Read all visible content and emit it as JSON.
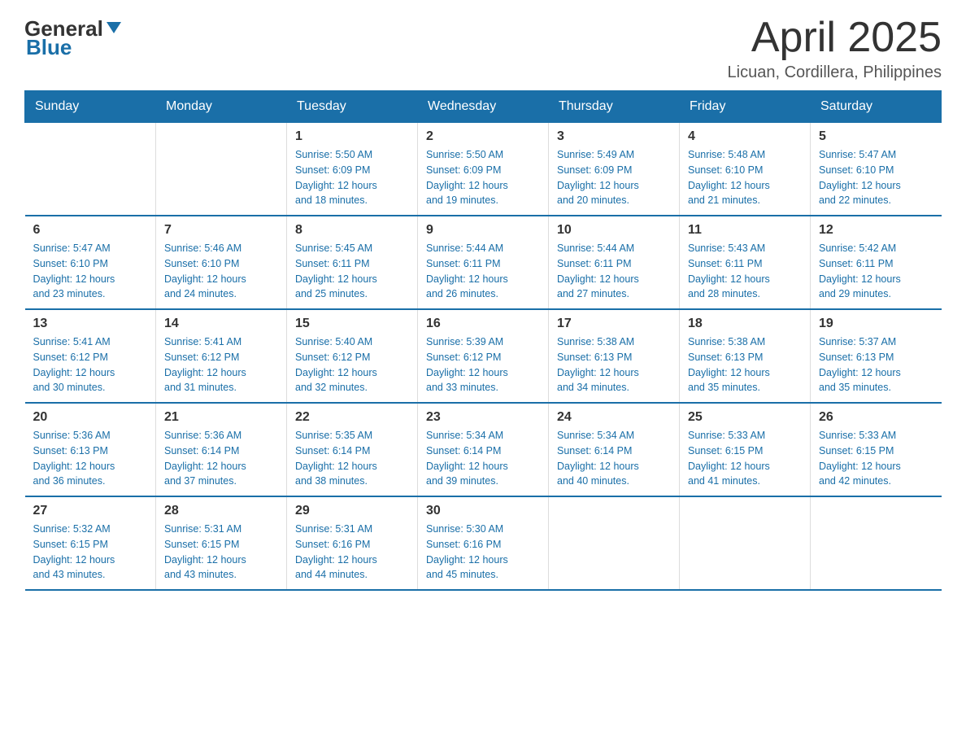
{
  "header": {
    "logo_general": "General",
    "logo_blue": "Blue",
    "month": "April 2025",
    "location": "Licuan, Cordillera, Philippines"
  },
  "days_of_week": [
    "Sunday",
    "Monday",
    "Tuesday",
    "Wednesday",
    "Thursday",
    "Friday",
    "Saturday"
  ],
  "weeks": [
    [
      {
        "day": "",
        "info": ""
      },
      {
        "day": "",
        "info": ""
      },
      {
        "day": "1",
        "info": "Sunrise: 5:50 AM\nSunset: 6:09 PM\nDaylight: 12 hours\nand 18 minutes."
      },
      {
        "day": "2",
        "info": "Sunrise: 5:50 AM\nSunset: 6:09 PM\nDaylight: 12 hours\nand 19 minutes."
      },
      {
        "day": "3",
        "info": "Sunrise: 5:49 AM\nSunset: 6:09 PM\nDaylight: 12 hours\nand 20 minutes."
      },
      {
        "day": "4",
        "info": "Sunrise: 5:48 AM\nSunset: 6:10 PM\nDaylight: 12 hours\nand 21 minutes."
      },
      {
        "day": "5",
        "info": "Sunrise: 5:47 AM\nSunset: 6:10 PM\nDaylight: 12 hours\nand 22 minutes."
      }
    ],
    [
      {
        "day": "6",
        "info": "Sunrise: 5:47 AM\nSunset: 6:10 PM\nDaylight: 12 hours\nand 23 minutes."
      },
      {
        "day": "7",
        "info": "Sunrise: 5:46 AM\nSunset: 6:10 PM\nDaylight: 12 hours\nand 24 minutes."
      },
      {
        "day": "8",
        "info": "Sunrise: 5:45 AM\nSunset: 6:11 PM\nDaylight: 12 hours\nand 25 minutes."
      },
      {
        "day": "9",
        "info": "Sunrise: 5:44 AM\nSunset: 6:11 PM\nDaylight: 12 hours\nand 26 minutes."
      },
      {
        "day": "10",
        "info": "Sunrise: 5:44 AM\nSunset: 6:11 PM\nDaylight: 12 hours\nand 27 minutes."
      },
      {
        "day": "11",
        "info": "Sunrise: 5:43 AM\nSunset: 6:11 PM\nDaylight: 12 hours\nand 28 minutes."
      },
      {
        "day": "12",
        "info": "Sunrise: 5:42 AM\nSunset: 6:11 PM\nDaylight: 12 hours\nand 29 minutes."
      }
    ],
    [
      {
        "day": "13",
        "info": "Sunrise: 5:41 AM\nSunset: 6:12 PM\nDaylight: 12 hours\nand 30 minutes."
      },
      {
        "day": "14",
        "info": "Sunrise: 5:41 AM\nSunset: 6:12 PM\nDaylight: 12 hours\nand 31 minutes."
      },
      {
        "day": "15",
        "info": "Sunrise: 5:40 AM\nSunset: 6:12 PM\nDaylight: 12 hours\nand 32 minutes."
      },
      {
        "day": "16",
        "info": "Sunrise: 5:39 AM\nSunset: 6:12 PM\nDaylight: 12 hours\nand 33 minutes."
      },
      {
        "day": "17",
        "info": "Sunrise: 5:38 AM\nSunset: 6:13 PM\nDaylight: 12 hours\nand 34 minutes."
      },
      {
        "day": "18",
        "info": "Sunrise: 5:38 AM\nSunset: 6:13 PM\nDaylight: 12 hours\nand 35 minutes."
      },
      {
        "day": "19",
        "info": "Sunrise: 5:37 AM\nSunset: 6:13 PM\nDaylight: 12 hours\nand 35 minutes."
      }
    ],
    [
      {
        "day": "20",
        "info": "Sunrise: 5:36 AM\nSunset: 6:13 PM\nDaylight: 12 hours\nand 36 minutes."
      },
      {
        "day": "21",
        "info": "Sunrise: 5:36 AM\nSunset: 6:14 PM\nDaylight: 12 hours\nand 37 minutes."
      },
      {
        "day": "22",
        "info": "Sunrise: 5:35 AM\nSunset: 6:14 PM\nDaylight: 12 hours\nand 38 minutes."
      },
      {
        "day": "23",
        "info": "Sunrise: 5:34 AM\nSunset: 6:14 PM\nDaylight: 12 hours\nand 39 minutes."
      },
      {
        "day": "24",
        "info": "Sunrise: 5:34 AM\nSunset: 6:14 PM\nDaylight: 12 hours\nand 40 minutes."
      },
      {
        "day": "25",
        "info": "Sunrise: 5:33 AM\nSunset: 6:15 PM\nDaylight: 12 hours\nand 41 minutes."
      },
      {
        "day": "26",
        "info": "Sunrise: 5:33 AM\nSunset: 6:15 PM\nDaylight: 12 hours\nand 42 minutes."
      }
    ],
    [
      {
        "day": "27",
        "info": "Sunrise: 5:32 AM\nSunset: 6:15 PM\nDaylight: 12 hours\nand 43 minutes."
      },
      {
        "day": "28",
        "info": "Sunrise: 5:31 AM\nSunset: 6:15 PM\nDaylight: 12 hours\nand 43 minutes."
      },
      {
        "day": "29",
        "info": "Sunrise: 5:31 AM\nSunset: 6:16 PM\nDaylight: 12 hours\nand 44 minutes."
      },
      {
        "day": "30",
        "info": "Sunrise: 5:30 AM\nSunset: 6:16 PM\nDaylight: 12 hours\nand 45 minutes."
      },
      {
        "day": "",
        "info": ""
      },
      {
        "day": "",
        "info": ""
      },
      {
        "day": "",
        "info": ""
      }
    ]
  ]
}
